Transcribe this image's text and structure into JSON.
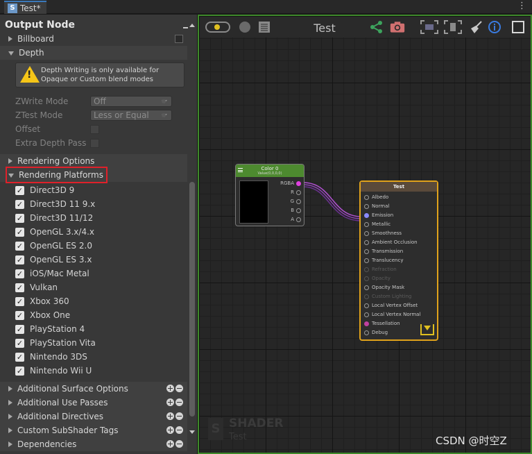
{
  "window": {
    "tab_title": "Test*",
    "tab_logo": "S",
    "menu_glyph": "⋮"
  },
  "panel": {
    "title": "Output Node",
    "top_rows": [
      {
        "label": "Billboard",
        "expanded": false
      },
      {
        "label": "Depth",
        "expanded": true
      }
    ],
    "warning": "Depth Writing is only available for Opaque or Custom blend modes",
    "fields": [
      {
        "label": "ZWrite Mode",
        "value": "Off"
      },
      {
        "label": "ZTest Mode",
        "value": "Less or Equal"
      },
      {
        "label": "Offset",
        "value": ""
      },
      {
        "label": "Extra Depth Pass",
        "value": ""
      }
    ],
    "rendering_options": "Rendering Options",
    "rendering_platforms": "Rendering Platforms",
    "platforms": [
      "Direct3D 9",
      "Direct3D 11 9.x",
      "Direct3D 11/12",
      "OpenGL 3.x/4.x",
      "OpenGL ES 2.0",
      "OpenGL ES 3.x",
      "iOS/Mac Metal",
      "Vulkan",
      "Xbox 360",
      "Xbox One",
      "PlayStation 4",
      "PlayStation Vita",
      "Nintendo 3DS",
      "Nintendo Wii U"
    ],
    "bottom_sections": [
      "Additional Surface Options",
      "Additional Use Passes",
      "Additional Directives",
      "Custom SubShader Tags",
      "Dependencies"
    ]
  },
  "graph": {
    "title": "Test",
    "color_node": {
      "title": "Color 0",
      "subtitle": "Value(0,0,0,0)",
      "outputs": [
        "RGBA",
        "R",
        "G",
        "B",
        "A"
      ]
    },
    "output_node": {
      "title": "Test",
      "inputs": [
        {
          "label": "Albedo",
          "enabled": true,
          "color": ""
        },
        {
          "label": "Normal",
          "enabled": true,
          "color": ""
        },
        {
          "label": "Emission",
          "enabled": true,
          "color": "#8a8aff"
        },
        {
          "label": "Metallic",
          "enabled": true,
          "color": ""
        },
        {
          "label": "Smoothness",
          "enabled": true,
          "color": ""
        },
        {
          "label": "Ambient Occlusion",
          "enabled": true,
          "color": ""
        },
        {
          "label": "Transmission",
          "enabled": true,
          "color": ""
        },
        {
          "label": "Translucency",
          "enabled": true,
          "color": ""
        },
        {
          "label": "Refraction",
          "enabled": false,
          "color": ""
        },
        {
          "label": "Opacity",
          "enabled": false,
          "color": ""
        },
        {
          "label": "Opacity Mask",
          "enabled": true,
          "color": ""
        },
        {
          "label": "Custom Lighting",
          "enabled": false,
          "color": ""
        },
        {
          "label": "Local Vertex Offset",
          "enabled": true,
          "color": ""
        },
        {
          "label": "Local Vertex Normal",
          "enabled": true,
          "color": ""
        },
        {
          "label": "Tessellation",
          "enabled": true,
          "color": "#c040a0"
        },
        {
          "label": "Debug",
          "enabled": true,
          "color": ""
        }
      ]
    },
    "watermark": {
      "logo": "S",
      "line1": "SHADER",
      "line2": "Test"
    },
    "credit": "CSDN @时空Z"
  },
  "colors": {
    "graph_border": "#3e8a2a",
    "output_node_border": "#e0a21b",
    "highlight": "#e0202a",
    "wire": "#b050d0"
  }
}
